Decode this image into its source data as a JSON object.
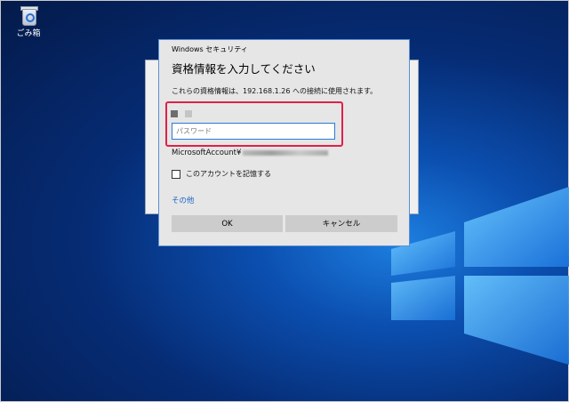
{
  "desktop": {
    "recycle_bin_label": "ごみ箱",
    "icon_name": "recycle-bin-icon"
  },
  "dialog": {
    "window_title": "Windows セキュリティ",
    "heading": "資格情報を入力してください",
    "description": "これらの資格情報は、192.168.1.26 への接続に使用されます。",
    "password_placeholder": "パスワード",
    "password_value": "",
    "account_prefix": "MicrosoftAccount¥",
    "remember_label": "このアカウントを記憶する",
    "remember_checked": false,
    "more_options": "その他",
    "ok_label": "OK",
    "cancel_label": "キャンセル"
  },
  "colors": {
    "highlight": "#e0204a",
    "link": "#1a64c8",
    "input_border": "#2b79d8"
  }
}
